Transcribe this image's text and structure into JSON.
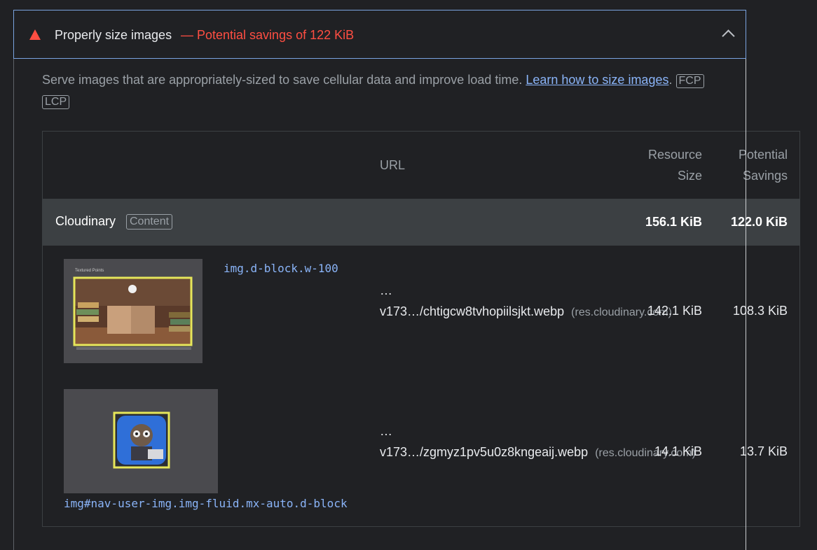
{
  "audit": {
    "title": "Properly size images",
    "savings": "— Potential savings of 122 KiB",
    "description_text": "Serve images that are appropriately-sized to save cellular data and improve load time. ",
    "learn_link": "Learn how to size images",
    "period": ".",
    "tags": [
      "FCP",
      "LCP"
    ]
  },
  "table": {
    "headers": {
      "url": "URL",
      "resource_size_1": "Resource",
      "resource_size_2": "Size",
      "savings_1": "Potential",
      "savings_2": "Savings"
    },
    "group": {
      "name": "Cloudinary",
      "tag": "Content",
      "resource_size": "156.1 KiB",
      "savings": "122.0 KiB"
    },
    "rows": [
      {
        "selector": "img.d-block.w-100",
        "ellipsis": "…",
        "url": "v173…/chtigcw8tvhopiilsjkt.webp",
        "host": "(res.cloudinary.com)",
        "resource_size": "142.1 KiB",
        "savings": "108.3 KiB",
        "thumb_caption": "Textured Points"
      },
      {
        "selector": "img#nav-user-img.img-fluid.mx-auto.d-block",
        "ellipsis": "…",
        "url": "v173…/zgmyz1pv5u0z8kngeaij.webp",
        "host": "(res.cloudinary.com)",
        "resource_size": "14.1 KiB",
        "savings": "13.7 KiB"
      }
    ]
  },
  "colors": {
    "fail": "#ff4e42",
    "link": "#8ab4f8",
    "highlight": "#e6e65a"
  }
}
